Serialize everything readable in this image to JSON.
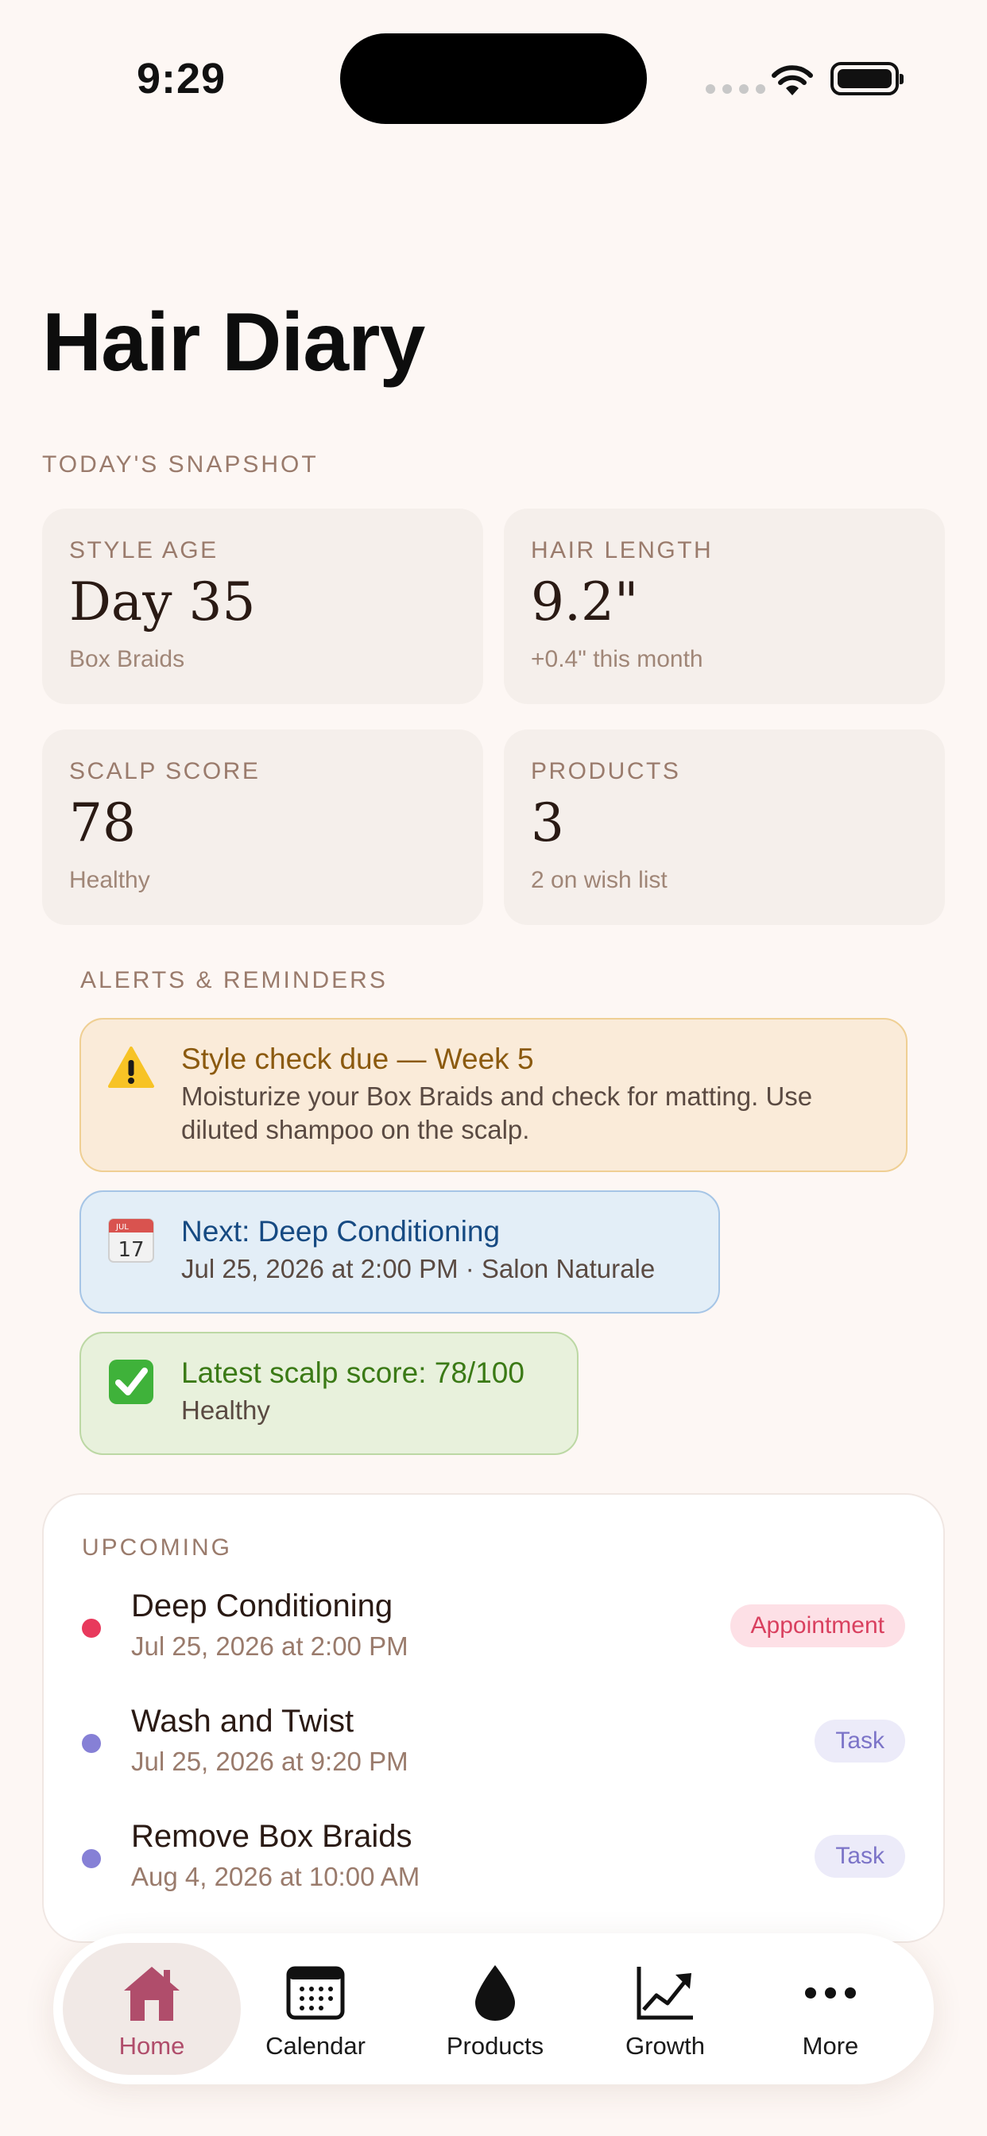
{
  "status_bar": {
    "time": "9:29"
  },
  "page": {
    "title": "Hair Diary"
  },
  "snapshot": {
    "label": "TODAY'S SNAPSHOT",
    "cards": [
      {
        "label": "STYLE AGE",
        "value": "Day 35",
        "sub": "Box Braids"
      },
      {
        "label": "HAIR LENGTH",
        "value": "9.2\"",
        "sub": "+0.4\" this month"
      },
      {
        "label": "SCALP SCORE",
        "value": "78",
        "sub": "Healthy"
      },
      {
        "label": "PRODUCTS",
        "value": "3",
        "sub": "2 on wish list"
      }
    ]
  },
  "alerts": {
    "label": "ALERTS & REMINDERS",
    "items": [
      {
        "icon": "warning-icon",
        "title": "Style check due — Week 5",
        "body": "Moisturize your Box Braids and check for matting. Use diluted shampoo on the scalp."
      },
      {
        "icon": "calendar-icon",
        "title": "Next: Deep Conditioning",
        "body": "Jul 25, 2026 at 2:00 PM · Salon Naturale"
      },
      {
        "icon": "checkmark-icon",
        "title": "Latest scalp score: 78/100",
        "body": "Healthy"
      }
    ]
  },
  "upcoming": {
    "label": "UPCOMING",
    "items": [
      {
        "title": "Deep Conditioning",
        "date": "Jul 25, 2026 at 2:00 PM",
        "badge": "Appointment",
        "color": "#e8395c"
      },
      {
        "title": "Wash and Twist",
        "date": "Jul 25, 2026 at 9:20 PM",
        "badge": "Task",
        "color": "#8680d6"
      },
      {
        "title": "Remove Box Braids",
        "date": "Aug 4, 2026 at 10:00 AM",
        "badge": "Task",
        "color": "#8680d6"
      }
    ]
  },
  "tabbar": {
    "tabs": [
      {
        "label": "Home",
        "icon": "house-icon",
        "active": true
      },
      {
        "label": "Calendar",
        "icon": "calendar-icon"
      },
      {
        "label": "Products",
        "icon": "droplet-icon"
      },
      {
        "label": "Growth",
        "icon": "chart-icon"
      },
      {
        "label": "More",
        "icon": "ellipsis-icon"
      }
    ]
  },
  "colors": {
    "accent": "#b04d6b",
    "background": "#fdf7f4"
  }
}
